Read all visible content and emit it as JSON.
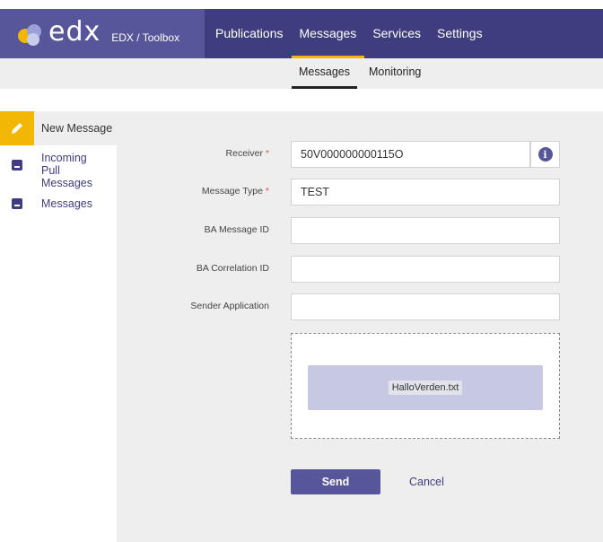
{
  "brand": {
    "name": "edx",
    "subtitle": "EDX / Toolbox"
  },
  "nav": {
    "items": [
      {
        "label": "Publications",
        "active": false
      },
      {
        "label": "Messages",
        "active": true
      },
      {
        "label": "Services",
        "active": false
      },
      {
        "label": "Settings",
        "active": false
      }
    ]
  },
  "subnav": {
    "items": [
      {
        "label": "Messages",
        "active": true
      },
      {
        "label": "Monitoring",
        "active": false
      }
    ]
  },
  "sidebar": {
    "items": [
      {
        "label": "New Message",
        "icon": "pencil-icon",
        "active": true
      },
      {
        "label": "Incoming Pull Messages",
        "icon": "inbox-icon",
        "active": false
      },
      {
        "label": "Messages",
        "icon": "inbox-icon",
        "active": false
      }
    ]
  },
  "form": {
    "receiver": {
      "label": "Receiver",
      "required_mark": "*",
      "value": "50V000000000115O"
    },
    "message_type": {
      "label": "Message Type",
      "required_mark": "*",
      "value": "TEST"
    },
    "ba_message_id": {
      "label": "BA Message ID",
      "value": ""
    },
    "ba_correlation_id": {
      "label": "BA Correlation ID",
      "value": ""
    },
    "sender_application": {
      "label": "Sender Application",
      "value": ""
    },
    "info_glyph": "i"
  },
  "attachment": {
    "file_name": "HalloVerden.txt"
  },
  "actions": {
    "send_label": "Send",
    "cancel_label": "Cancel"
  },
  "colors": {
    "primary": "#3f3d7f",
    "brand_bg": "#58569a",
    "accent": "#f2b705",
    "panel_bg": "#eeeeee",
    "file_card": "#c7c8e4"
  }
}
